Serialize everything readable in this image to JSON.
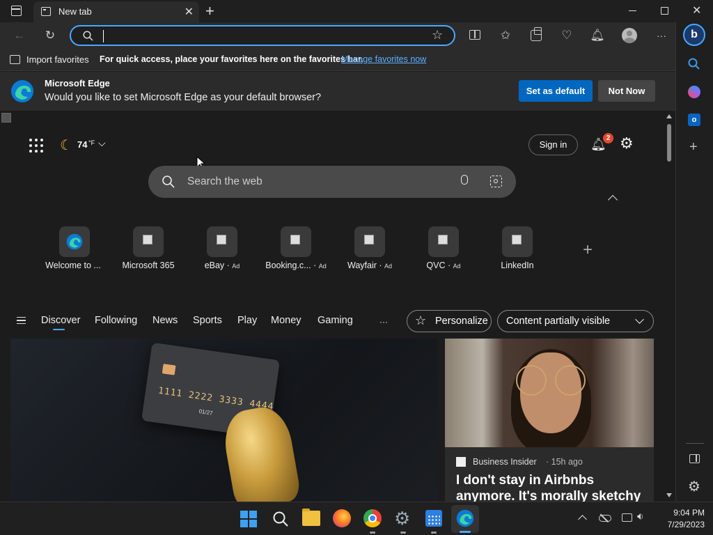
{
  "tab": {
    "title": "New tab"
  },
  "address": {
    "value": ""
  },
  "favorites_bar": {
    "import_label": "Import favorites",
    "message": "For quick access, place your favorites here on the favorites bar.",
    "manage_link": "Manage favorites now"
  },
  "banner": {
    "title": "Microsoft Edge",
    "question": "Would you like to set Microsoft Edge as your default browser?",
    "primary_button": "Set as default",
    "secondary_button": "Not Now"
  },
  "page_header": {
    "weather_temp": "74",
    "weather_unit": "°F",
    "sign_in": "Sign in",
    "notification_count": "2"
  },
  "search": {
    "placeholder": "Search the web"
  },
  "quick_links": [
    {
      "label": "Welcome to ...",
      "ad": ""
    },
    {
      "label": "Microsoft 365",
      "ad": ""
    },
    {
      "label": "eBay",
      "ad": "Ad"
    },
    {
      "label": "Booking.c...",
      "ad": "Ad"
    },
    {
      "label": "Wayfair",
      "ad": "Ad"
    },
    {
      "label": "QVC",
      "ad": "Ad"
    },
    {
      "label": "LinkedIn",
      "ad": ""
    }
  ],
  "feed_tabs": [
    "Discover",
    "Following",
    "News",
    "Sports",
    "Play",
    "Money",
    "Gaming"
  ],
  "feed_more": "···",
  "personalize_label": "Personalize",
  "content_dropdown": "Content partially visible",
  "card_left": {
    "card_number": "1111 2222 3333 4444",
    "card_expiry": "01/27"
  },
  "card_right": {
    "source": "Business Insider",
    "age": "· 15h ago",
    "headline": "I don't stay in Airbnbs anymore. It's morally sketchy"
  },
  "clock": {
    "time": "9:04 PM",
    "date": "7/29/2023"
  },
  "colors": {
    "accent": "#4aa8ff",
    "primary_button": "#0067c0",
    "notification_badge": "#e8472d"
  }
}
